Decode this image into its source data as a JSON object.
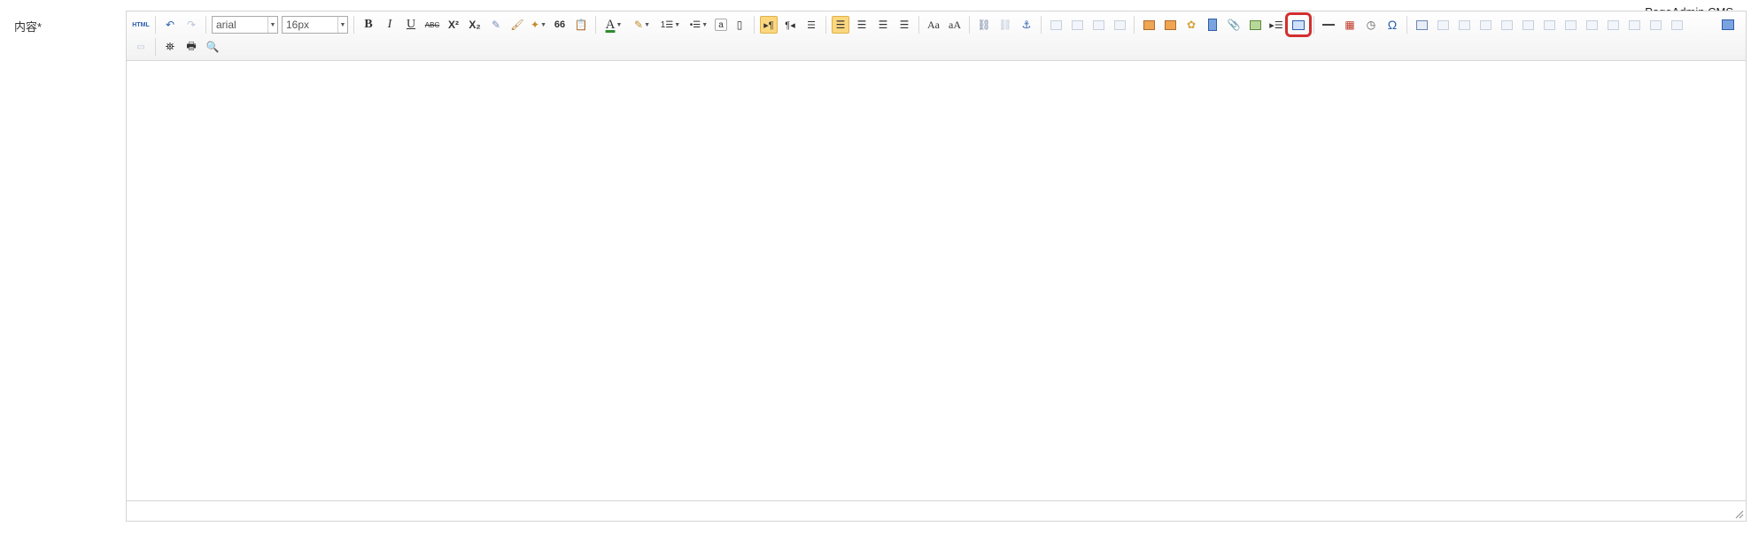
{
  "brand": "PageAdmin CMS",
  "field_label": "内容*",
  "toolbar": {
    "html_label": "HTML",
    "font_family": "arial",
    "font_size": "16px",
    "bold": "B",
    "italic": "I",
    "underline": "U",
    "strikethrough": "ABC",
    "superscript": "X²",
    "subscript": "X₂",
    "blockquote": "66",
    "forecolor": "A",
    "ordered_list": "1☰",
    "unordered_list": "•☰",
    "special_chars": "Ω"
  },
  "colors": {
    "accent": "#fcd77e",
    "highlight": "#d32f2f",
    "forecolor_underline": "#2e8b2e"
  }
}
